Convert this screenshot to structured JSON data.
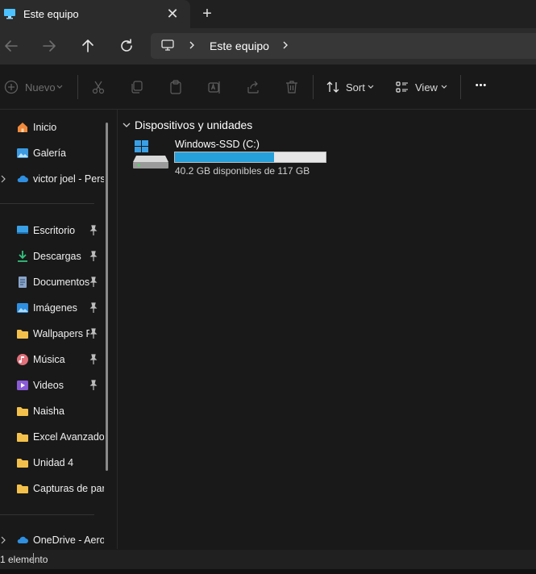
{
  "tab": {
    "title": "Este equipo",
    "close": "✕",
    "new": "+"
  },
  "address": {
    "location": "Este equipo"
  },
  "toolbar": {
    "new_label": "Nuevo",
    "sort_label": "Sort",
    "view_label": "View",
    "more_label": "•••"
  },
  "sidebar": {
    "items": [
      {
        "label": "Inicio",
        "icon": "home-icon"
      },
      {
        "label": "Galería",
        "icon": "gallery-icon"
      },
      {
        "label": "victor joel - Pers",
        "icon": "cloud-icon"
      },
      {
        "label": "Escritorio",
        "icon": "desktop-icon",
        "pinned": true
      },
      {
        "label": "Descargas",
        "icon": "download-icon",
        "pinned": true
      },
      {
        "label": "Documentos",
        "icon": "document-icon",
        "pinned": true
      },
      {
        "label": "Imágenes",
        "icon": "pictures-icon",
        "pinned": true
      },
      {
        "label": "Wallpapers P",
        "icon": "folder-icon",
        "pinned": true
      },
      {
        "label": "Música",
        "icon": "music-icon",
        "pinned": true
      },
      {
        "label": "Videos",
        "icon": "video-icon",
        "pinned": true
      },
      {
        "label": "Naisha",
        "icon": "folder-icon"
      },
      {
        "label": "Excel Avanzado",
        "icon": "folder-icon"
      },
      {
        "label": "Unidad 4",
        "icon": "folder-icon"
      },
      {
        "label": "Capturas de par",
        "icon": "folder-icon"
      },
      {
        "label": "OneDrive - Aero",
        "icon": "cloud-icon"
      }
    ]
  },
  "content": {
    "group_title": "Dispositivos y unidades",
    "drive": {
      "name": "Windows-SSD (C:)",
      "space_text": "40.2 GB disponibles de 117 GB",
      "used_fraction": 0.656
    }
  },
  "status": {
    "text": "1 elemento"
  },
  "colors": {
    "accent": "#26a0da",
    "folder": "#f3c14b",
    "background": "#191919"
  }
}
